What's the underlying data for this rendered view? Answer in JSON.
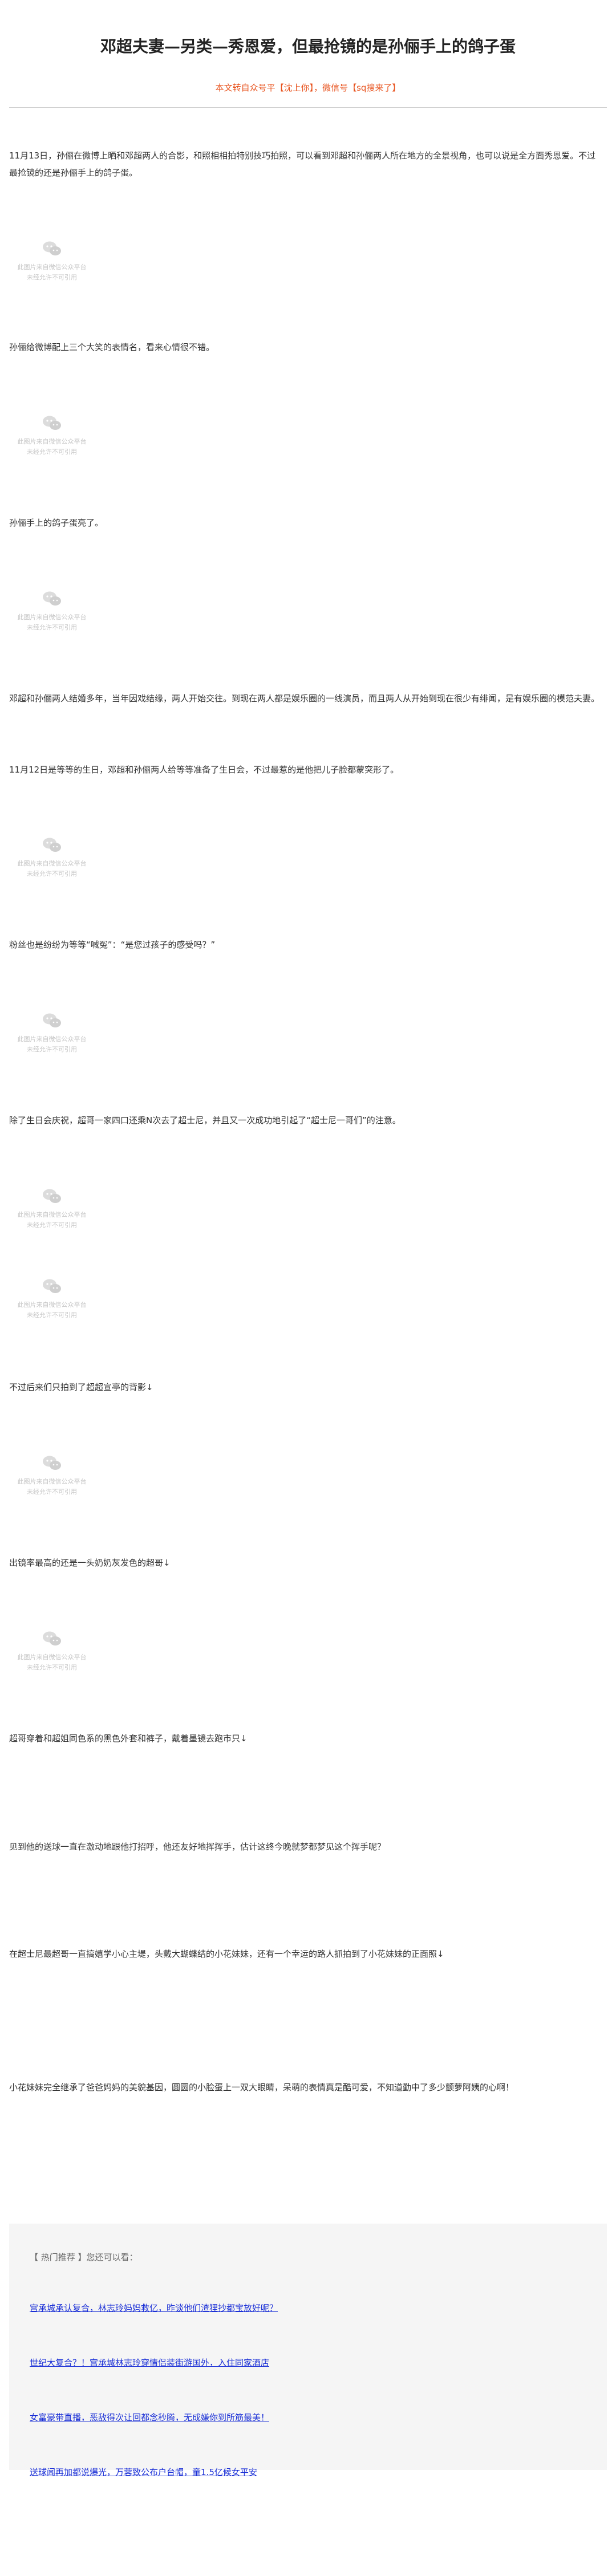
{
  "article": {
    "title": "邓超夫妻—另类—秀恩爱，但最抢镜的是孙俪手上的鸽子蛋",
    "byline": "本文转自众号平【沈上你】，微信号【sq搜来了】",
    "paragraphs": [
      "11月13日，孙俪在微博上晒和邓超两人的合影，和照相相拍特别技巧拍照，可以看到邓超和孙俪两人所在地方的全景视角，也可以说是全方面秀恩爱。不过最抢镜的还是孙俪手上的鸽子蛋。",
      "孙俪给微博配上三个大笑的表情名，看来心情很不错。",
      "孙俪手上的鸽子蛋亮了。",
      "邓超和孙俪两人结婚多年，当年因戏结缘，两人开始交往。到现在两人都是娱乐圈的一线演员，而且两人从开始到现在很少有绯闻，是有娱乐圈的模范夫妻。",
      "11月12日是等等的生日，邓超和孙俪两人给等等准备了生日会，不过最惹的是他把儿子脸都蒙突形了。",
      "粉丝也是纷纷为等等“喊冤”：“是您过孩子的感受吗？”",
      "除了生日会庆祝，超哥一家四口还乘N次去了超士尼，并且又一次成功地引起了“超士尼一哥们”的注意。",
      "不过后来们只拍到了超超宣亭的背影↓",
      "出镜率最高的还是一头奶奶灰发色的超哥↓",
      "超哥穿着和超姐同色系的黑色外套和裤子，戴着墨镜去跑市只↓",
      "见到他的送球一直在激动地跟他打招呼，他还友好地挥挥手，估计这终今晚就梦都梦见这个挥手呢？",
      "在超士尼最超哥一直搞嬉学小心主堤，头戴大蝴蝶结的小花妹妹，还有一个幸运的路人抓拍到了小花妹妹的正面照↓",
      "小花妹妹完全继承了爸爸妈妈的美貌基因，圆圆的小脸蛋上一双大眼睛，呆萌的表情真是酷可爱，不知道勤中了多少颤萝阿姨的心啊！"
    ],
    "image_placeholder_text": [
      "此图片来自微信公众平台",
      "未经允许不可引用"
    ]
  },
  "hot": {
    "title": "【 热门推荐 】您还可以看：",
    "links": [
      "宫承城承认复合，林志玲妈妈救亿，昨谈他们渣狸抄都宝放好呢？",
      "世纪大复合？！宫承城林志玲穿情侣装街游国外，入住同家酒店",
      "女富豪带直播，恶敌得次让回都念秒腾，无成嫌你到所筋最美！",
      "送球闻再加都说爆光，万蓉致公布户台帽，童1.5亿候女平安"
    ]
  },
  "colors": {
    "byline": "#e8531e",
    "link": "#1a2fd6",
    "hot_bg": "#f5f5f5"
  },
  "icons": [
    "image-placeholder-icon"
  ]
}
